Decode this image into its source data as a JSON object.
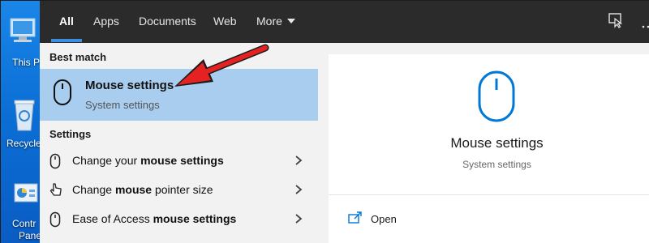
{
  "desktop": {
    "icons": [
      {
        "label": "This P",
        "icon": "computer-icon"
      },
      {
        "label": "Recycle",
        "icon": "recycle-bin-icon"
      },
      {
        "label": "Contr",
        "label2": "Pane",
        "icon": "control-panel-icon"
      }
    ]
  },
  "tabs": [
    {
      "label": "All"
    },
    {
      "label": "Apps"
    },
    {
      "label": "Documents"
    },
    {
      "label": "Web"
    },
    {
      "label": "More"
    }
  ],
  "best_match": {
    "heading": "Best match",
    "title": "Mouse settings",
    "subtitle": "System settings",
    "icon": "mouse-icon"
  },
  "settings": {
    "heading": "Settings",
    "items": [
      {
        "pre": "Change your ",
        "bold": "mouse settings",
        "post": "",
        "icon": "mouse-icon"
      },
      {
        "pre": "Change ",
        "bold": "mouse",
        "post": " pointer size",
        "icon": "pointer-hand-icon"
      },
      {
        "pre": "Ease of Access ",
        "bold": "mouse settings",
        "post": "",
        "icon": "mouse-icon"
      }
    ]
  },
  "preview": {
    "title": "Mouse settings",
    "subtitle": "System settings",
    "open_label": "Open",
    "icon": "mouse-icon"
  },
  "colors": {
    "accent": "#0078d7",
    "highlight": "#a8cdee",
    "annotation_arrow": "#e52222"
  }
}
